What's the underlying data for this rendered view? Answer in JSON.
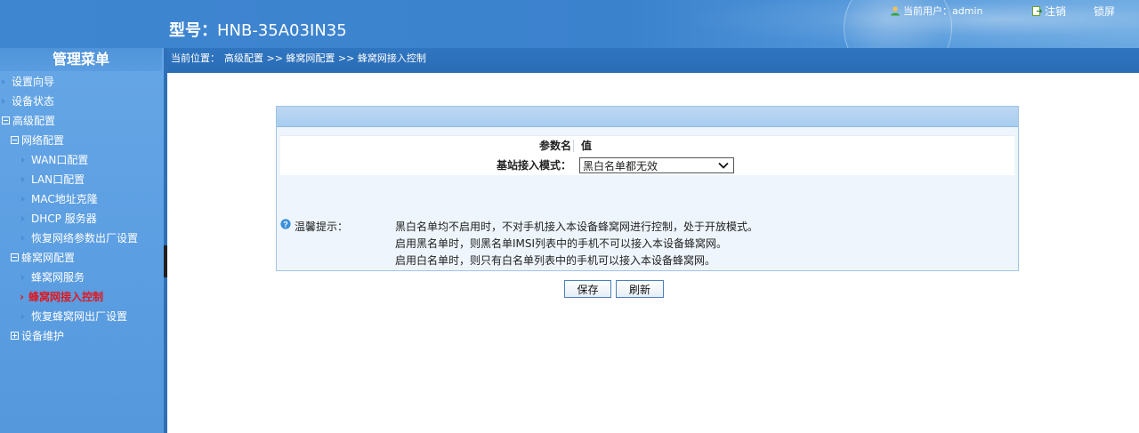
{
  "header": {
    "model_label": "型号：",
    "model_value": "HNB-35A03IN35",
    "current_user": "当前用户：admin",
    "logout": "注销",
    "lock": "锁屏"
  },
  "breadcrumb": {
    "prefix": "当前位置：",
    "path": "高级配置 >> 蜂窝网配置 >> 蜂窝网接入控制"
  },
  "sidebar": {
    "title": "管理菜单",
    "items": [
      {
        "label": "设置向导"
      },
      {
        "label": "设备状态"
      },
      {
        "label": "高级配置"
      },
      {
        "label": "网络配置"
      },
      {
        "label": "WAN口配置"
      },
      {
        "label": "LAN口配置"
      },
      {
        "label": "MAC地址克隆"
      },
      {
        "label": "DHCP 服务器"
      },
      {
        "label": "恢复网络参数出厂设置"
      },
      {
        "label": "蜂窝网配置"
      },
      {
        "label": "蜂窝网服务"
      },
      {
        "label": "蜂窝网接入控制"
      },
      {
        "label": "恢复蜂窝网出厂设置"
      },
      {
        "label": "设备维护"
      }
    ]
  },
  "table": {
    "col_name": "参数名",
    "col_value": "值",
    "row_label": "基站接入模式：",
    "select_value": "黑白名单都无效"
  },
  "tips": {
    "label": "温馨提示：",
    "lines": [
      "黑白名单均不启用时，不对手机接入本设备蜂窝网进行控制，处于开放模式。",
      "启用黑名单时，则黑名单IMSI列表中的手机不可以接入本设备蜂窝网。",
      "启用白名单时，则只有白名单列表中的手机可以接入本设备蜂窝网。"
    ]
  },
  "buttons": {
    "save": "保存",
    "refresh": "刷新"
  }
}
